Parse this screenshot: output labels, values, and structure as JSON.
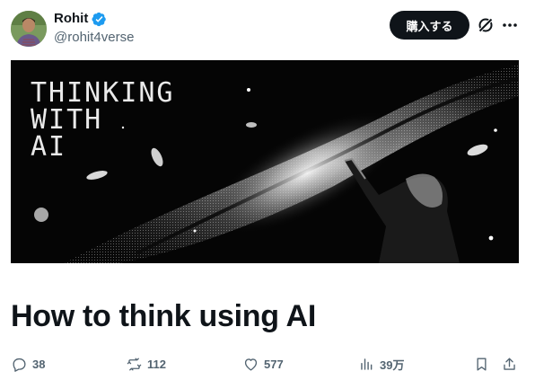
{
  "author": {
    "display_name": "Rohit",
    "handle": "@rohit4verse",
    "verified": true
  },
  "header": {
    "buy_label": "購入する"
  },
  "media": {
    "title_text": "THINKING\nWITH\nAI"
  },
  "article": {
    "title": "How to think using AI"
  },
  "actions": {
    "replies": "38",
    "reposts": "112",
    "likes": "577",
    "views": "39万"
  },
  "colors": {
    "verified_badge": "#1d9bf0",
    "text_primary": "#0f1419",
    "text_secondary": "#536471",
    "button_bg": "#0f1419"
  }
}
